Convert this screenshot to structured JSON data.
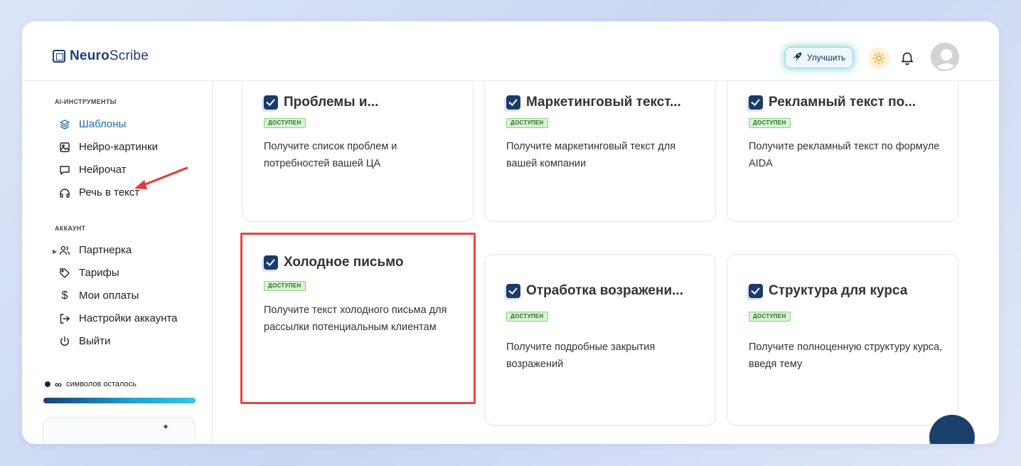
{
  "header": {
    "logo_bold": "Neuro",
    "logo_regular": "Scribe",
    "upgrade_label": "Улучшить"
  },
  "sidebar": {
    "section_tools": "AI-ИНСТРУМЕНТЫ",
    "tools": [
      {
        "label": "Шаблоны",
        "icon": "layers-icon",
        "active": true
      },
      {
        "label": "Нейро-картинки",
        "icon": "image-icon"
      },
      {
        "label": "Нейрочат",
        "icon": "chat-icon"
      },
      {
        "label": "Речь в текст",
        "icon": "headphones-icon"
      }
    ],
    "section_account": "АККАУНТ",
    "account": [
      {
        "label": "Партнерка",
        "icon": "users-icon"
      },
      {
        "label": "Тарифы",
        "icon": "tag-icon"
      },
      {
        "label": "Мои оплаты",
        "icon": "dollar-icon"
      },
      {
        "label": "Настройки аккаунта",
        "icon": "logout-arrow-icon"
      },
      {
        "label": "Выйти",
        "icon": "power-icon"
      }
    ],
    "symbols_infinity": "∞",
    "symbols_label": "символов осталось",
    "symbols_progress": 1.0
  },
  "cards": [
    {
      "title": "Проблемы и...",
      "badge": "ДОСТУПЕН",
      "desc": "Получите список проблем и потребностей вашей ЦА"
    },
    {
      "title": "Маркетинговый текст...",
      "badge": "ДОСТУПЕН",
      "desc": "Получите маркетинговый текст для вашей компании"
    },
    {
      "title": "Рекламный текст по...",
      "badge": "ДОСТУПЕН",
      "desc": "Получите рекламный текст по формуле AIDA"
    },
    {
      "title": "Холодное письмо",
      "badge": "ДОСТУПЕН",
      "desc": "Получите текст холодного письма для рассылки потенциальным клиентам"
    },
    {
      "title": "Отработка возражени...",
      "badge": "ДОСТУПЕН",
      "desc": "Получите подробные закрытия возражений"
    },
    {
      "title": "Структура для курса",
      "badge": "ДОСТУПЕН",
      "desc": "Получите полноценную структуру курса, введя тему"
    }
  ],
  "colors": {
    "accent": "#1f6fb2",
    "badge_bg": "#d7f5d2",
    "highlight": "#ec4343",
    "annotation_arrow": "#e53935"
  }
}
